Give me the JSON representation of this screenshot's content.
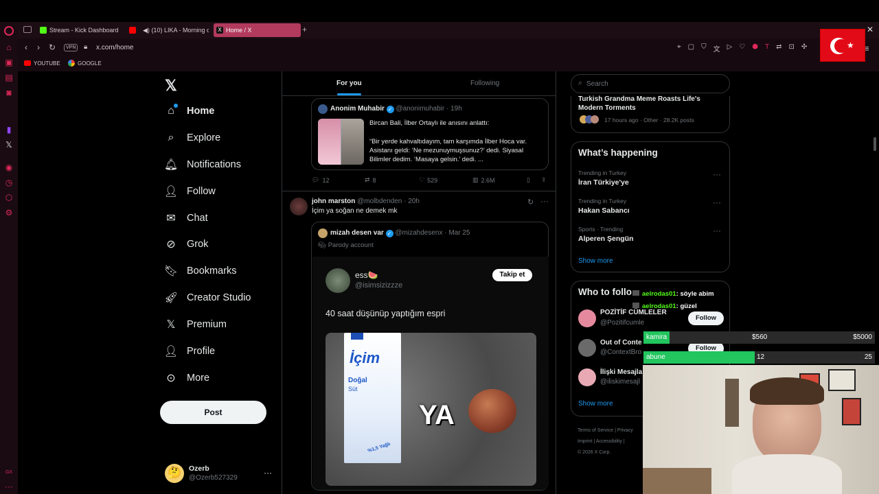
{
  "browser": {
    "tabs": [
      {
        "label": "Stream - Kick Dashboard",
        "icon": "kick-icon",
        "color": "#53fc18"
      },
      {
        "label": "(10) LIKA - Morning co",
        "icon": "youtube-icon",
        "color": "#ff0000"
      },
      {
        "label": "Home / X",
        "icon": "x-icon",
        "color": "#000000"
      }
    ],
    "url": "x.com/home",
    "vpn": "VPN",
    "bookmarks": [
      "YOUTUBE",
      "GOOGLE"
    ],
    "accent": "#e0285a"
  },
  "nav": {
    "items": [
      "Home",
      "Explore",
      "Notifications",
      "Follow",
      "Chat",
      "Grok",
      "Bookmarks",
      "Creator Studio",
      "Premium",
      "Profile",
      "More"
    ],
    "post_label": "Post",
    "account": {
      "name": "Ozerb",
      "handle": "@Ozerb527329"
    }
  },
  "feed": {
    "tabs": [
      "For you",
      "Following"
    ],
    "quoted": {
      "name": "Anonim Muhabir",
      "handle": "@anonimuhabir",
      "time": "· 19h",
      "line1": "Bircan Bali, İlber Ortaylı ile anısını anlattı:",
      "line2": "“Bir yerde kahvaltıdayım, tam karşımda İlber Hoca var. Asistanı geldi: ‘Ne mezunuymuşsunuz?’ dedi. Siyasal Bilimler dedim. ‘Masaya gelsin.’ dedi. ..."
    },
    "stats": {
      "replies": "12",
      "reposts": "8",
      "likes": "529",
      "views": "2.6M"
    },
    "post2": {
      "name": "john marston",
      "handle": "@molbdenden",
      "time": "· 20h",
      "text": "İçim ya soğan ne demek mk",
      "quote": {
        "name": "mizah desen var",
        "handle": "@mizahdesenx",
        "time": "· Mar 25",
        "parody": "Parody account",
        "inner_name": "ess🍉",
        "inner_handle": "@isimsizizzze",
        "follow_btn": "Takip et",
        "text": "40 saat düşünüp yaptığım espri",
        "image_text": "YA",
        "carton_brand": "İçim",
        "carton_label1": "Doğal",
        "carton_label2": "Süt",
        "carton_fat": "%1,5 Yağlı"
      }
    }
  },
  "right": {
    "search_placeholder": "Search",
    "top_story": {
      "title": "Turkish Grandma Meme Roasts Life's Modern Torments",
      "meta": "17 hours ago · Other · 28.2K posts"
    },
    "whats_happening": "What’s happening",
    "trends": [
      {
        "sub": "Trending in Turkey",
        "title": "İran Türkiye'ye"
      },
      {
        "sub": "Trending in Turkey",
        "title": "Hakan Sabancı"
      },
      {
        "sub": "Sports · Trending",
        "title": "Alperen Şengün"
      }
    ],
    "show_more": "Show more",
    "who_to_follow": "Who to follo",
    "suggestions": [
      {
        "name": "POZİTİF CÜMLELER",
        "handle": "@Pozitifcumle",
        "btn": "Follow"
      },
      {
        "name": "Out of Conte",
        "handle": "@ContextBro",
        "btn": "Follow"
      },
      {
        "name": "İlişki Mesajla",
        "handle": "@iliskimesajl",
        "btn": ""
      }
    ],
    "show_more2": "Show more",
    "footer": [
      "Terms of Service",
      "|",
      "Privacy",
      "Imprint",
      "|",
      "Accessibility",
      "|",
      "© 2026 X Corp."
    ]
  },
  "stream_overlay": {
    "chat": [
      {
        "user": "aelrodas01",
        "msg": ": söyle abim"
      },
      {
        "user": "aelrodas01",
        "msg": ": güzel"
      }
    ],
    "goals": [
      {
        "label": "kamira",
        "current": "$560",
        "target": "$5000",
        "progress": 0.112
      },
      {
        "label": "abune",
        "current": "12",
        "target": "25",
        "progress": 0.48
      }
    ]
  }
}
